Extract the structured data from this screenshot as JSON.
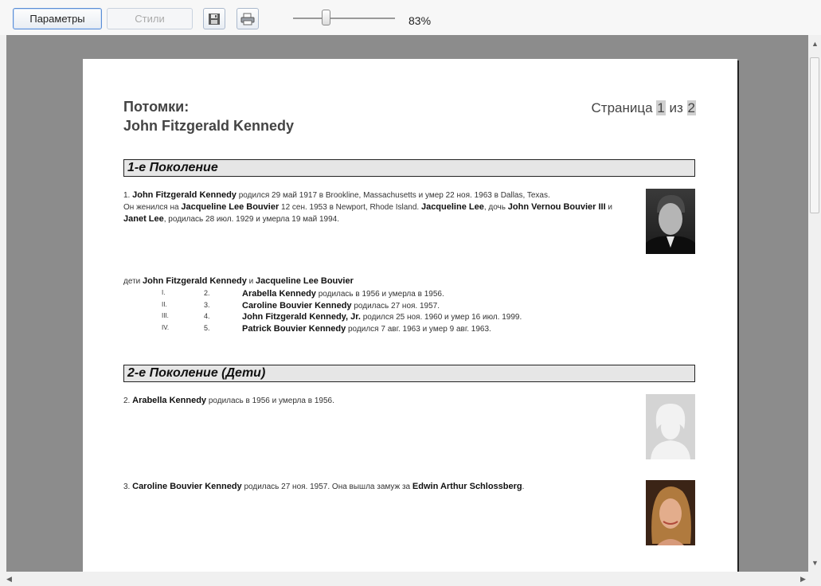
{
  "toolbar": {
    "params_label": "Параметры",
    "styles_label": "Стили",
    "save_icon": "save-icon",
    "print_icon": "print-icon",
    "zoom": "83%"
  },
  "page": {
    "title": "Потомки:",
    "person": "John Fitzgerald Kennedy",
    "page_word": "Страница",
    "page_current": "1",
    "page_of": "из",
    "page_total": "2"
  },
  "gen1": {
    "header": "1-е Поколение",
    "p1_num": "1. ",
    "p1_name": "John Fitzgerald Kennedy",
    "p1_t1": " родился  29 май 1917 в Brookline, Massachusetts и умер  22 ноя. 1963 в Dallas, Texas.",
    "p1_t2": "Он женился на ",
    "p1_spouse": "Jacqueline Lee Bouvier",
    "p1_t3": " 12 сен. 1953 в Newport, Rhode Island. ",
    "p1_spouse_short": "Jacqueline Lee",
    "p1_t4": ", дочь ",
    "p1_father": "John Vernou Bouvier III",
    "p1_t5": " и ",
    "p1_mother": "Janet Lee",
    "p1_t6": ", родилась  28 июл. 1929 и умерла  19 май 1994.",
    "kids_prefix": "дети ",
    "kids_p1": "John Fitzgerald Kennedy",
    "kids_and": " и ",
    "kids_p2": "Jacqueline Lee Bouvier",
    "children": [
      {
        "roman": "I.",
        "num": "2.",
        "name": "Arabella Kennedy",
        "text": " родилась в 1956 и умерла в 1956."
      },
      {
        "roman": "II.",
        "num": "3.",
        "name": "Caroline Bouvier Kennedy",
        "text": " родилась  27 ноя. 1957."
      },
      {
        "roman": "III.",
        "num": "4.",
        "name": "John Fitzgerald Kennedy, Jr.",
        "text": " родился  25 ноя. 1960 и умер  16 июл. 1999."
      },
      {
        "roman": "IV.",
        "num": "5.",
        "name": "Patrick Bouvier Kennedy",
        "text": " родился  7 авг. 1963 и умер  9 авг. 1963."
      }
    ]
  },
  "gen2": {
    "header": "2-е Поколение (Дети)",
    "p2_num": "2. ",
    "p2_name": "Arabella Kennedy",
    "p2_text": " родилась в 1956 и умерла в 1956.",
    "p3_num": "3. ",
    "p3_name": "Caroline Bouvier Kennedy",
    "p3_t1": " родилась  27 ноя. 1957.   Она вышла замуж за ",
    "p3_spouse": "Edwin Arthur Schlossberg",
    "p3_t2": "."
  }
}
